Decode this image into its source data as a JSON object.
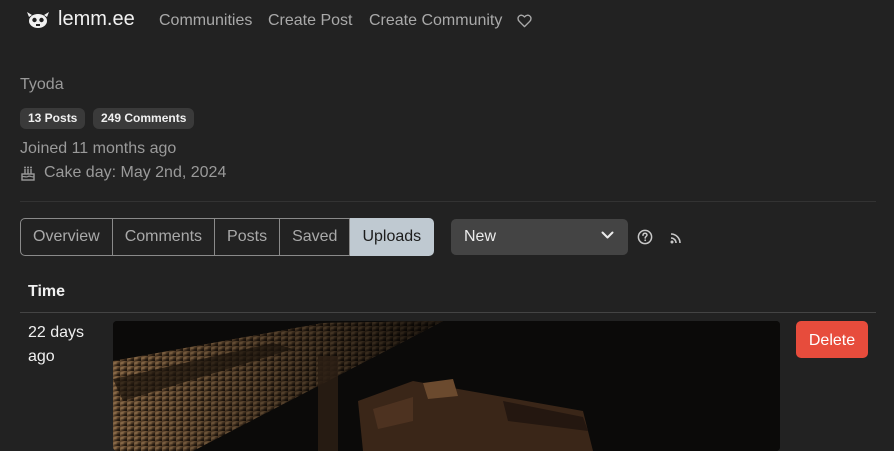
{
  "navbar": {
    "brand": "lemm.ee",
    "links": [
      "Communities",
      "Create Post",
      "Create Community"
    ],
    "donate_icon": "heart-icon",
    "brand_icon": "lemmy-logo-icon"
  },
  "profile": {
    "username": "Tyoda",
    "posts_badge": "13 Posts",
    "comments_badge": "249 Comments",
    "joined": "Joined 11 months ago",
    "cake_day": "Cake day: May 2nd, 2024"
  },
  "tabs": [
    "Overview",
    "Comments",
    "Posts",
    "Saved",
    "Uploads"
  ],
  "active_tab": "Uploads",
  "sort": {
    "selected": "New"
  },
  "table": {
    "header": "Time",
    "rows": [
      {
        "time": "22 days ago",
        "action": "Delete"
      }
    ]
  },
  "colors": {
    "background": "#222222",
    "active_tab": "#bfc9d1",
    "delete": "#e74c3c"
  }
}
